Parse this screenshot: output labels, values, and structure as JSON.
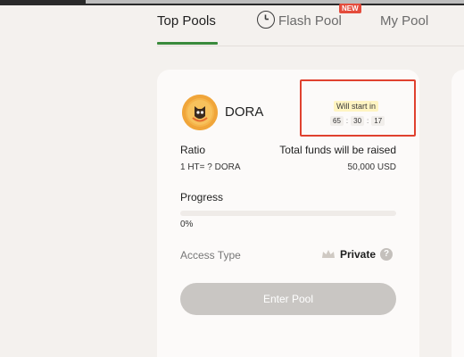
{
  "tabs": [
    {
      "label": "Top Pools",
      "active": true
    },
    {
      "label": "Flash Pool",
      "badge": "NEW",
      "icon": "clock-icon"
    },
    {
      "label": "My Pool"
    }
  ],
  "pool": {
    "token_name": "DORA",
    "token_icon": "dora-token-logo",
    "countdown": {
      "label": "Will start in",
      "hours": "65",
      "minutes": "30",
      "seconds": "17"
    },
    "ratio_label": "Ratio",
    "ratio_value": "1 HT= ? DORA",
    "funds_label": "Total funds will be raised",
    "funds_value": "50,000 USD",
    "progress_label": "Progress",
    "progress_value": 0,
    "progress_text": "0%",
    "access_label": "Access Type",
    "access_value": "Private",
    "access_icon": "crown-icon",
    "help_icon": "help-icon",
    "enter_label": "Enter Pool"
  },
  "colors": {
    "accent": "#3a8a3c",
    "badge": "#e44c3c",
    "highlight_border": "#e0412f",
    "button_disabled": "#c9c6c3"
  }
}
